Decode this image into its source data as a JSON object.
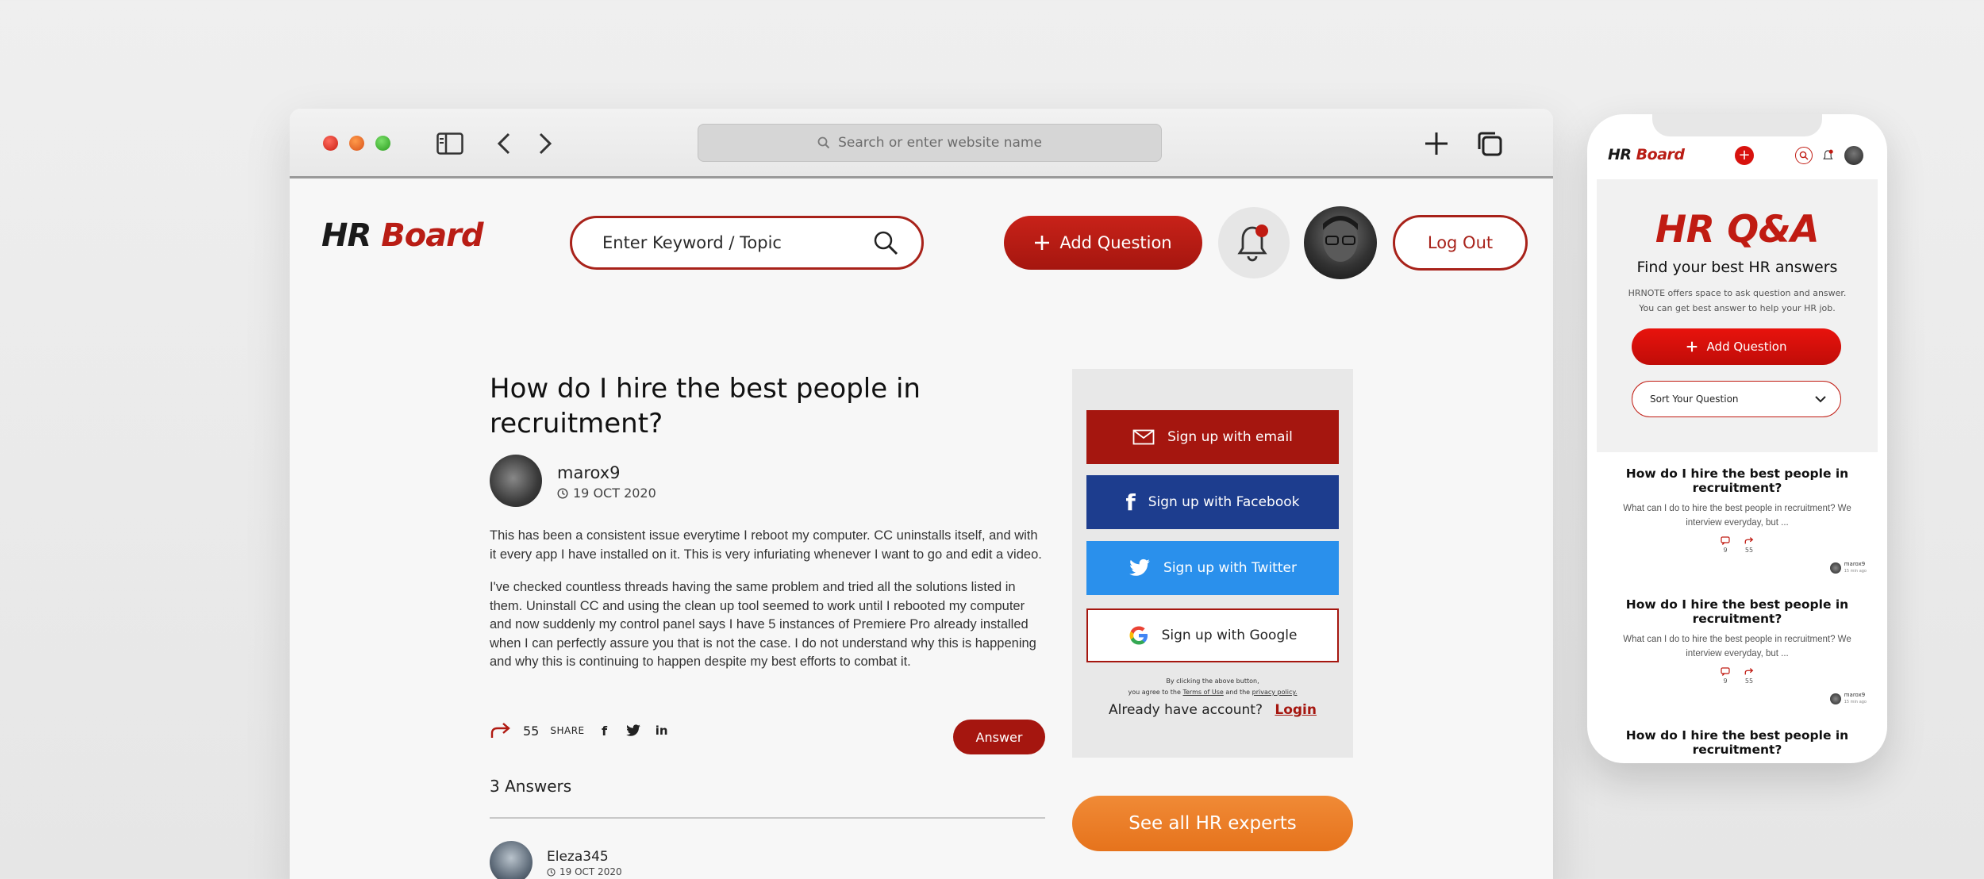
{
  "browser": {
    "url_placeholder": "Search or enter website name"
  },
  "site": {
    "logo_part1": "HR",
    "logo_part2": "Board",
    "search_placeholder": "Enter Keyword / Topic",
    "add_question_label": "Add Question",
    "logout_label": "Log Out"
  },
  "question": {
    "title": "How do I hire the best people in recruitment?",
    "author": "marox9",
    "date": "19 OCT 2020",
    "paragraph1": "This has been a consistent issue everytime I reboot my computer. CC uninstalls itself, and with it every app I have installed on it. This is very infuriating whenever I want to go and edit a video.",
    "paragraph2": "I've checked countless threads having the same problem and tried all the solutions listed in them. Uninstall CC and using the clean up tool seemed to work until I rebooted my computer and now suddenly my control panel says I have 5 instances of Premiere Pro already installed when I can perfectly assure you that is not the case. I do not understand why this is happening and why this is continuing to happen despite my best efforts to combat it.",
    "share_count": "55",
    "share_label": "SHARE",
    "answer_button": "Answer",
    "answers_count_label": "3 Answers"
  },
  "answer": {
    "author": "Eleza345",
    "date": "19 OCT 2020"
  },
  "signup": {
    "email": "Sign up with email",
    "facebook": "Sign up with Facebook",
    "twitter": "Sign up with Twitter",
    "google": "Sign up with Google",
    "terms_line1": "By clicking the above button,",
    "terms_prefix": "you agree to the",
    "terms_link": "Terms of Use",
    "terms_and": "and the",
    "privacy_link": "privacy policy.",
    "have_account": "Already have account?",
    "login_label": "Login",
    "experts_button": "See all HR experts"
  },
  "mobile": {
    "logo_part1": "HR",
    "logo_part2": "Board",
    "title": "HR Q&A",
    "subtitle": "Find your best HR answers",
    "desc_line1": "HRNOTE offers space to ask question and answer.",
    "desc_line2": "You can get best answer to help your HR job.",
    "add_question_label": "Add Question",
    "sort_label": "Sort Your Question",
    "cards": [
      {
        "question": "How do I hire the best people in recruitment?",
        "desc": "What can I do to hire the best people in recruitment? We interview everyday, but ...",
        "comments": "9",
        "shares": "55",
        "author": "marox9",
        "time": "15 min ago"
      },
      {
        "question": "How do I hire the best people in recruitment?",
        "desc": "What can I do to hire the best people in recruitment? We interview everyday, but ...",
        "comments": "9",
        "shares": "55",
        "author": "marox9",
        "time": "15 min ago"
      },
      {
        "question": "How do I hire the best people in recruitment?"
      }
    ]
  },
  "colors": {
    "brand_red": "#a5160f",
    "facebook_blue": "#1d3d8e",
    "twitter_blue": "#2a90ec",
    "experts_orange": "#e6731c"
  }
}
